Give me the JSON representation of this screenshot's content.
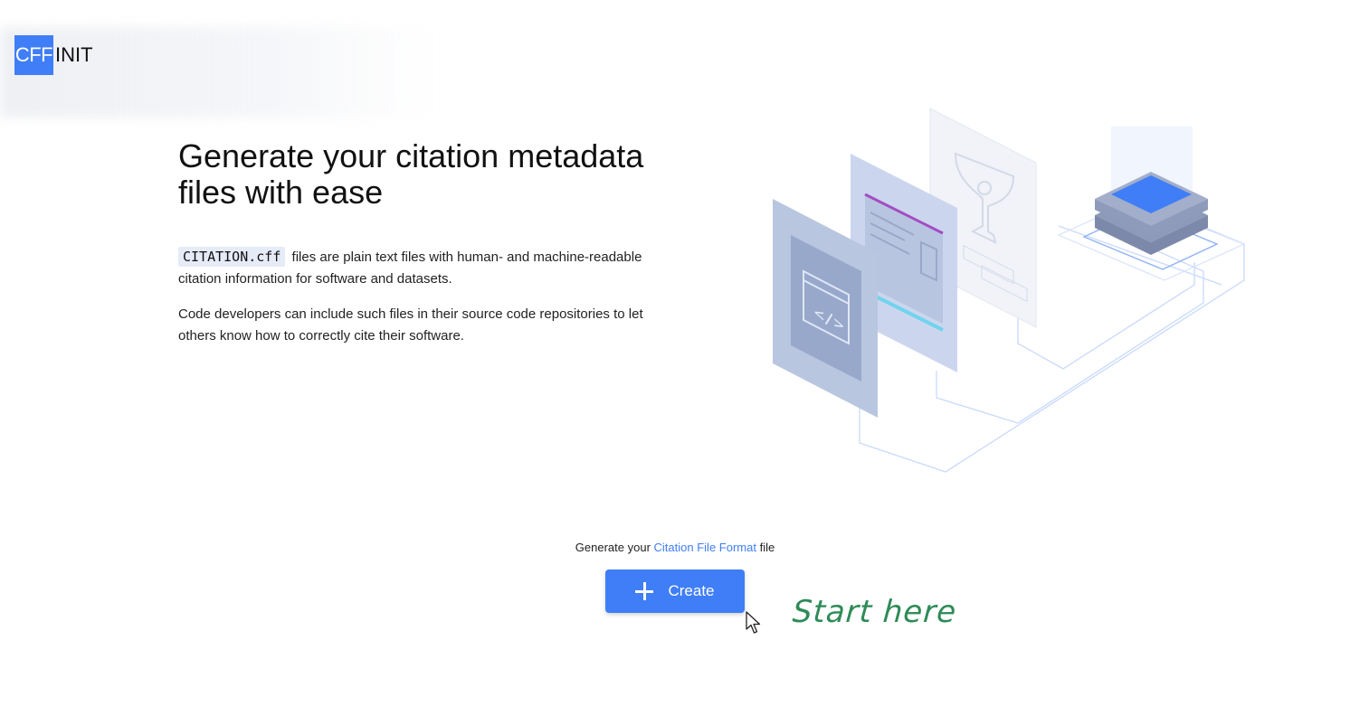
{
  "brand": {
    "logo_box": "CFF",
    "logo_rest": "INIT",
    "accent_color": "#3f7ef6"
  },
  "hero": {
    "title": "Generate your citation metadata files with ease",
    "para1_code": "CITATION.cff",
    "para1_text": "files are plain text files with human- and machine-readable citation information for software and datasets.",
    "para2_text": "Code developers can include such files in their source code repositories to let others know how to correctly cite their software."
  },
  "cta": {
    "prefix": "Generate your",
    "link": "Citation File Format",
    "suffix": "file",
    "button_label": "Create",
    "button_icon": "plus-icon"
  },
  "annotation": {
    "text": "Start here",
    "color": "#2e8b57"
  },
  "illustration": {
    "code_icon": "</>"
  }
}
